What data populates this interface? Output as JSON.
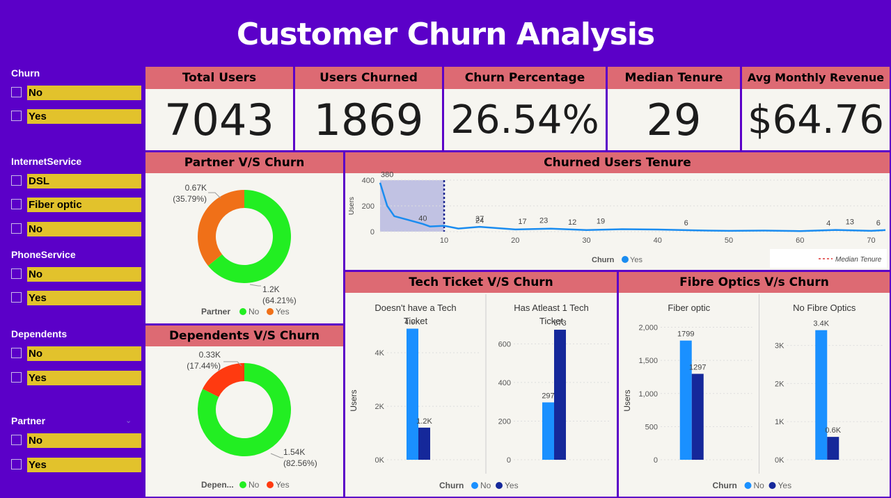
{
  "title": "Customer Churn Analysis",
  "slicers": [
    {
      "label": "Churn",
      "options": [
        "No",
        "Yes"
      ]
    },
    {
      "label": "InternetService",
      "options": [
        "DSL",
        "Fiber optic",
        "No"
      ]
    },
    {
      "label": "PhoneService",
      "options": [
        "No",
        "Yes"
      ]
    },
    {
      "label": "Dependents",
      "options": [
        "No",
        "Yes"
      ]
    },
    {
      "label": "Partner",
      "options": [
        "No",
        "Yes"
      ]
    }
  ],
  "kpis": [
    {
      "label": "Total Users",
      "value": "7043"
    },
    {
      "label": "Users Churned",
      "value": "1869"
    },
    {
      "label": "Churn Percentage",
      "value": "26.54%"
    },
    {
      "label": "Median Tenure",
      "value": "29"
    },
    {
      "label": "Avg Monthly Revenue",
      "value": "$64.76"
    }
  ],
  "colors": {
    "no_green": "#22ee22",
    "yes_orange": "#f07018",
    "yes_red": "#ff3a10",
    "no_blue": "#1a90ff",
    "yes_navy": "#15289a",
    "line": "#1a8cf0",
    "header": "#dd6a73"
  },
  "chart_data": [
    {
      "type": "pie",
      "title": "Partner V/S Churn",
      "legend_title": "Partner",
      "slices": [
        {
          "name": "No",
          "value": 1200,
          "label": "1.2K (64.21%)"
        },
        {
          "name": "Yes",
          "value": 670,
          "label": "0.67K (35.79%)"
        }
      ]
    },
    {
      "type": "pie",
      "title": "Dependents V/S Churn",
      "legend_title": "Depen...",
      "slices": [
        {
          "name": "No",
          "value": 1540,
          "label": "1.54K (82.56%)"
        },
        {
          "name": "Yes",
          "value": 330,
          "label": "0.33K (17.44%)"
        }
      ]
    },
    {
      "type": "line",
      "title": "Churned Users Tenure",
      "ylabel": "Users",
      "legend_title": "Churn",
      "series_name": "Yes",
      "xlim": [
        1,
        72
      ],
      "ylim": [
        0,
        400
      ],
      "xticks": [
        10,
        20,
        30,
        40,
        50,
        60,
        70
      ],
      "yticks": [
        0,
        200,
        400
      ],
      "reference_line": {
        "name": "Median Tenure",
        "x": 10
      },
      "x": [
        1,
        2,
        3,
        5,
        7,
        8,
        10,
        12,
        15,
        20,
        25,
        30,
        35,
        40,
        45,
        50,
        55,
        60,
        65,
        70,
        72
      ],
      "y": [
        380,
        200,
        120,
        90,
        60,
        40,
        45,
        24,
        37,
        17,
        23,
        12,
        19,
        16,
        10,
        6,
        8,
        4,
        13,
        6,
        12
      ],
      "data_labels": [
        {
          "x": 2,
          "y": 380,
          "text": "380"
        },
        {
          "x": 7,
          "y": 40,
          "text": "40"
        },
        {
          "x": 15,
          "y": 24,
          "text": "24"
        },
        {
          "x": 15,
          "y": 37,
          "text": "37"
        },
        {
          "x": 21,
          "y": 17,
          "text": "17"
        },
        {
          "x": 24,
          "y": 23,
          "text": "23"
        },
        {
          "x": 28,
          "y": 12,
          "text": "12"
        },
        {
          "x": 32,
          "y": 19,
          "text": "19"
        },
        {
          "x": 44,
          "y": 6,
          "text": "6"
        },
        {
          "x": 64,
          "y": 4,
          "text": "4"
        },
        {
          "x": 67,
          "y": 13,
          "text": "13"
        },
        {
          "x": 71,
          "y": 6,
          "text": "6"
        }
      ]
    },
    {
      "type": "bar",
      "title": "Tech Ticket V/S Churn",
      "ylabel": "Users",
      "legend_title": "Churn",
      "panels": [
        {
          "title": "Doesn't have a Tech Ticket",
          "yticks": [
            0,
            2000,
            4000
          ],
          "tick_labels": [
            "0K",
            "2K",
            "4K"
          ],
          "ymax": 5200,
          "series": [
            {
              "name": "No",
              "value": 4900,
              "label": "4.9K"
            },
            {
              "name": "Yes",
              "value": 1200,
              "label": "1.2K"
            }
          ]
        },
        {
          "title": "Has Atleast 1 Tech Ticket",
          "yticks": [
            0,
            200,
            400,
            600
          ],
          "tick_labels": [
            "0",
            "200",
            "400",
            "600"
          ],
          "ymax": 720,
          "series": [
            {
              "name": "No",
              "value": 297,
              "label": "297"
            },
            {
              "name": "Yes",
              "value": 673,
              "label": "673"
            }
          ]
        }
      ]
    },
    {
      "type": "bar",
      "title": "Fibre Optics V/s Churn",
      "ylabel": "Users",
      "legend_title": "Churn",
      "panels": [
        {
          "title": "Fiber optic",
          "yticks": [
            0,
            500,
            1000,
            1500,
            2000
          ],
          "tick_labels": [
            "0",
            "500",
            "1,000",
            "1,500",
            "2,000"
          ],
          "ymax": 2100,
          "series": [
            {
              "name": "No",
              "value": 1799,
              "label": "1799"
            },
            {
              "name": "Yes",
              "value": 1297,
              "label": "1297"
            }
          ]
        },
        {
          "title": "No Fibre Optics",
          "yticks": [
            0,
            1000,
            2000,
            3000
          ],
          "tick_labels": [
            "0K",
            "1K",
            "2K",
            "3K"
          ],
          "ymax": 3650,
          "series": [
            {
              "name": "No",
              "value": 3400,
              "label": "3.4K"
            },
            {
              "name": "Yes",
              "value": 600,
              "label": "0.6K"
            }
          ]
        }
      ]
    }
  ]
}
